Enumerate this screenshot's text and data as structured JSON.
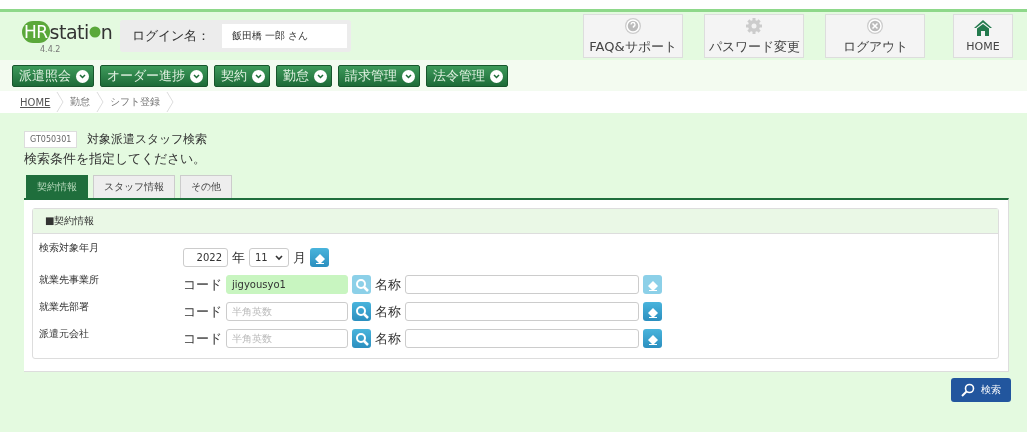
{
  "header": {
    "logo": {
      "text_a": "HR",
      "text_b": "stati",
      "text_c": "n",
      "version": "4.4.2"
    },
    "login_label": "ログイン名：",
    "login_name": "飯田橋 一郎 さん",
    "buttons": [
      {
        "kind": "help",
        "label": "FAQ&サポート"
      },
      {
        "kind": "gear",
        "label": "パスワード変更"
      },
      {
        "kind": "close",
        "label": "ログアウト"
      },
      {
        "kind": "home",
        "label": "HOME"
      }
    ]
  },
  "menu": [
    "派遣照会",
    "オーダー進捗",
    "契約",
    "勤怠",
    "請求管理",
    "法令管理"
  ],
  "breadcrumb": [
    "HOME",
    "勤怠",
    "シフト登録"
  ],
  "page": {
    "code": "GT050301",
    "title": "対象派遣スタッフ検索",
    "instruction": "検索条件を指定してください。"
  },
  "tabs": [
    {
      "label": "契約情報",
      "selected": true
    },
    {
      "label": "スタッフ情報",
      "selected": false
    },
    {
      "label": "その他",
      "selected": false
    }
  ],
  "section": {
    "title": "■契約情報",
    "period": {
      "label": "検索対象年月",
      "year": "2022",
      "year_unit": "年",
      "month": "11",
      "month_unit": "月"
    },
    "rows": [
      {
        "label": "就業先事業所",
        "code_label": "コード",
        "code_value": "jigyousyo1",
        "filled": true,
        "disabled": true,
        "name_label": "名称"
      },
      {
        "label": "就業先部署",
        "code_label": "コード",
        "code_placeholder": "半角英数",
        "filled": false,
        "disabled": false,
        "name_label": "名称"
      },
      {
        "label": "派遣元会社",
        "code_label": "コード",
        "code_placeholder": "半角英数",
        "filled": false,
        "disabled": false,
        "name_label": "名称"
      }
    ]
  },
  "search_button": "検索"
}
